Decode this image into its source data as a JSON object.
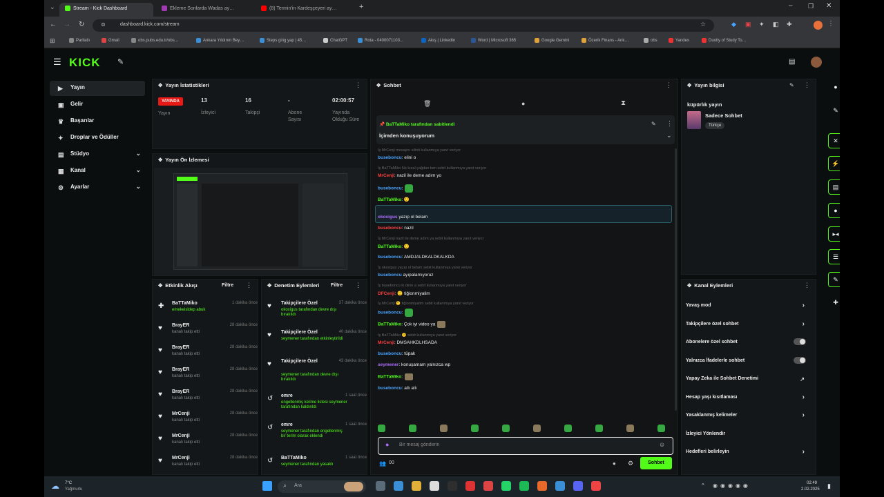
{
  "browser": {
    "tabs": [
      {
        "label": "Stream - Kick Dashboard",
        "color": "#53fc18"
      },
      {
        "label": "Ekleme Sonlarda Wadas ay…",
        "color": "#a03ab0"
      },
      {
        "label": "(8) Termin’in Kardeşçeyeri ay…",
        "color": "#ff0000"
      }
    ],
    "url": "dashboard.kick.com/stream",
    "bookmarks": [
      "Parllatlı",
      "Gmail",
      "obs.pubs.edu.tr/obs…",
      "Ankara Yıldırım Bey…",
      "Steps girig yap | 45…",
      "ChatGPT",
      "Rota - 0400071103…",
      "Akış | LinkedIn",
      "Word | Microsoft 365",
      "Google Gemini",
      "Özerik Finans - Ank…",
      "obs",
      "Yandex",
      "Duolty of Study To…"
    ]
  },
  "sidebar": {
    "items": [
      {
        "label": "Yayın",
        "icon": "video-icon",
        "glyph": "▶",
        "active": true
      },
      {
        "label": "Gelir",
        "icon": "wallet-icon",
        "glyph": "▣"
      },
      {
        "label": "Başarılar",
        "icon": "trophy-icon",
        "glyph": "♛"
      },
      {
        "label": "Droplar ve Ödüller",
        "icon": "gift-icon",
        "glyph": "✦"
      },
      {
        "label": "Stüdyo",
        "icon": "studio-icon",
        "glyph": "▤",
        "chevron": true
      },
      {
        "label": "Kanal",
        "icon": "channel-icon",
        "glyph": "▦",
        "chevron": true
      },
      {
        "label": "Ayarlar",
        "icon": "gear-icon",
        "glyph": "⚙",
        "chevron": true
      }
    ]
  },
  "stats": {
    "title": "Yayın İstatistikleri",
    "live_badge": "YAYINDA",
    "items": [
      {
        "label": "Yayın",
        "value": ""
      },
      {
        "label": "İzleyici",
        "value": "13"
      },
      {
        "label": "Takipçi",
        "value": "16"
      },
      {
        "label": "Abone Sayısı",
        "value": "-"
      },
      {
        "label": "Yayında Olduğu Süre",
        "value": "02:00:57"
      }
    ]
  },
  "preview": {
    "title": "Yayın Ön İzlemesi"
  },
  "activity": {
    "title": "Etkinlik Akışı",
    "filter": "Filtre",
    "items": [
      {
        "name": "BaTTaMiko",
        "sub": "emekeisldep abuk",
        "time": "1 dakika önce"
      },
      {
        "name": "BrayER",
        "sub": "kanalı takip etti",
        "time": "28 dakika önce"
      },
      {
        "name": "BrayER",
        "sub": "kanalı takip etti",
        "time": "28 dakika önce"
      },
      {
        "name": "BrayER",
        "sub": "kanalı takip etti",
        "time": "28 dakika önce"
      },
      {
        "name": "BrayER",
        "sub": "kanalı takip etti",
        "time": "28 dakika önce"
      },
      {
        "name": "MrCenji",
        "sub": "kanalı takip etti",
        "time": "28 dakika önce"
      },
      {
        "name": "MrCenji",
        "sub": "kanalı takip etti",
        "time": "28 dakika önce"
      },
      {
        "name": "MrCenji",
        "sub": "kanalı takip etti",
        "time": "28 dakika önce"
      }
    ]
  },
  "moderation": {
    "title": "Denetim Eylemleri",
    "filter": "Filtre",
    "items": [
      {
        "name": "Takipçilere Özel",
        "sub": "okoxigus tarafından devre dışı bırakıldı",
        "time": "37 dakika önce"
      },
      {
        "name": "Takipçilere Özel",
        "sub": "seymener tarafından etkinleştirildi",
        "time": "40 dakika önce"
      },
      {
        "name": "Takipçilere Özel",
        "sub": "seymener tarafından devre dışı bırakıldı",
        "time": "43 dakika önce"
      },
      {
        "name": "emre",
        "sub": "engellenmiş kelime listesi seymener tarafından kaldırıldı",
        "time": "1 saat önce"
      },
      {
        "name": "emre",
        "sub": "seymener tarafından engellenmiş bir terim olarak eklendi",
        "time": "1 saat önce"
      },
      {
        "name": "BaTTaMiko",
        "sub": "seymener tarafından yasaklı",
        "time": "1 saat önce"
      }
    ]
  },
  "chat": {
    "title": "Sohbet",
    "pinned_by": "BaTTaMiko tarafından sabitlendi",
    "pinned_msg": "İçimden konuşuyorum",
    "lines": [
      {
        "type": "sys",
        "text": "İş MrCenji mesajını silinti kullanmıya yanıt veriyor"
      },
      {
        "type": "msg",
        "user": "buseboncu",
        "color": "b",
        "text": ": elini o"
      },
      {
        "type": "sys",
        "text": "İş BaTTaMiko Ne kızal çağdan ben sebit kullanmıya yanıt veriyor"
      },
      {
        "type": "msg",
        "user": "MrCenji",
        "color": "r",
        "text": ": nazil ile deme adım yo"
      },
      {
        "type": "msg",
        "user": "buseboncu",
        "color": "b",
        "text": ":",
        "emote": true
      },
      {
        "type": "msg",
        "user": "BaTTaMiko",
        "color": "g",
        "text": ": 🙂"
      },
      {
        "type": "sys",
        "text": "İş buseboncu kedeği çalışmaları sebit kullanmıya yanıt veriyor"
      },
      {
        "type": "msg",
        "user": "okoxigus",
        "color": "p",
        "text": " yazıp ol belam",
        "highlight": true
      },
      {
        "type": "msg",
        "user": "buseboncu",
        "color": "r",
        "text": ": nazil"
      },
      {
        "type": "sys",
        "text": "İş MrCenji nazil ile deme adım ya sebit kullanmıya yanıt veriyor"
      },
      {
        "type": "msg",
        "user": "BaTTaMiko",
        "color": "g",
        "text": ": 🙂"
      },
      {
        "type": "msg",
        "user": "buseboncu",
        "color": "b",
        "text": ": AMDJALDKALDKALKDA"
      },
      {
        "type": "sys",
        "text": "İş okoxigus yazıp ol belam sebit kullanmıya yanıt veriyor"
      },
      {
        "type": "msg",
        "user": "buseboncu",
        "color": "b",
        "text": " ayıpalamıyoruz"
      },
      {
        "type": "sys",
        "text": "İş buseboncu ik dinin a sebit kullanmıya yanıt veriyor"
      },
      {
        "type": "msg",
        "user": "DFCenji",
        "color": "r",
        "text": ": 🙂 tiğionmiyalim"
      },
      {
        "type": "sys",
        "text": "İş MrCenji 🙂 tiğionmiyalim sebit kullanmıya yanıt veriyor"
      },
      {
        "type": "msg",
        "user": "buseboncu",
        "color": "b",
        "text": ":",
        "emote": true
      },
      {
        "type": "msg",
        "user": "BaTTaMiko",
        "color": "g",
        "text": ": Çok iyi video ya",
        "emote2": true
      },
      {
        "type": "sys",
        "text": "İş BaTTaMiko 🙂 sebit kullanmıya yanıt veriyor"
      },
      {
        "type": "msg",
        "user": "MrCenji",
        "color": "r",
        "text": ": DMSAHKDLHSADA"
      },
      {
        "type": "msg",
        "user": "buseboncu",
        "color": "b",
        "text": ": tüpak"
      },
      {
        "type": "msg",
        "user": "seymener",
        "color": "p",
        "text": ": konuşamam yalnızca wp"
      },
      {
        "type": "msg",
        "user": "BaTTaMiko",
        "color": "g",
        "text": ":",
        "emote2": true
      },
      {
        "type": "msg",
        "user": "buseboncu",
        "color": "b",
        "text": ": allı allı"
      }
    ],
    "input_placeholder": "Bir mesaj gönderin",
    "viewer_count": "00",
    "send_label": "Sohbet"
  },
  "stream_info": {
    "title": "Yayın bilgisi",
    "subtitle": "küpürlık yayın",
    "category": "Sadece Sohbet",
    "tag": "Türkçe"
  },
  "channel_actions": {
    "title": "Kanal Eylemleri",
    "items": [
      {
        "label": "Yavaş mod",
        "kind": "arrow"
      },
      {
        "label": "Takipçilere özel sohbet",
        "kind": "arrow"
      },
      {
        "label": "Abonelere özel sohbet",
        "kind": "toggle"
      },
      {
        "label": "Yalnızca İfadelerle sohbet",
        "kind": "toggle"
      },
      {
        "label": "Yapay Zeka ile Sohbet Denetimi",
        "kind": "ext"
      },
      {
        "label": "Hesap yaşı kısıtlaması",
        "kind": "arrow"
      },
      {
        "label": "Yasaklanmış kelimeler",
        "kind": "arrow"
      },
      {
        "label": "İzleyici Yönlendir",
        "kind": "none"
      },
      {
        "label": "Hedefleri belirleyin",
        "kind": "arrow"
      }
    ]
  },
  "taskbar": {
    "weather_temp": "7°C",
    "weather_desc": "Yağmurlu",
    "search_placeholder": "Ara",
    "time": "02:49",
    "date": "2.02.2025"
  }
}
